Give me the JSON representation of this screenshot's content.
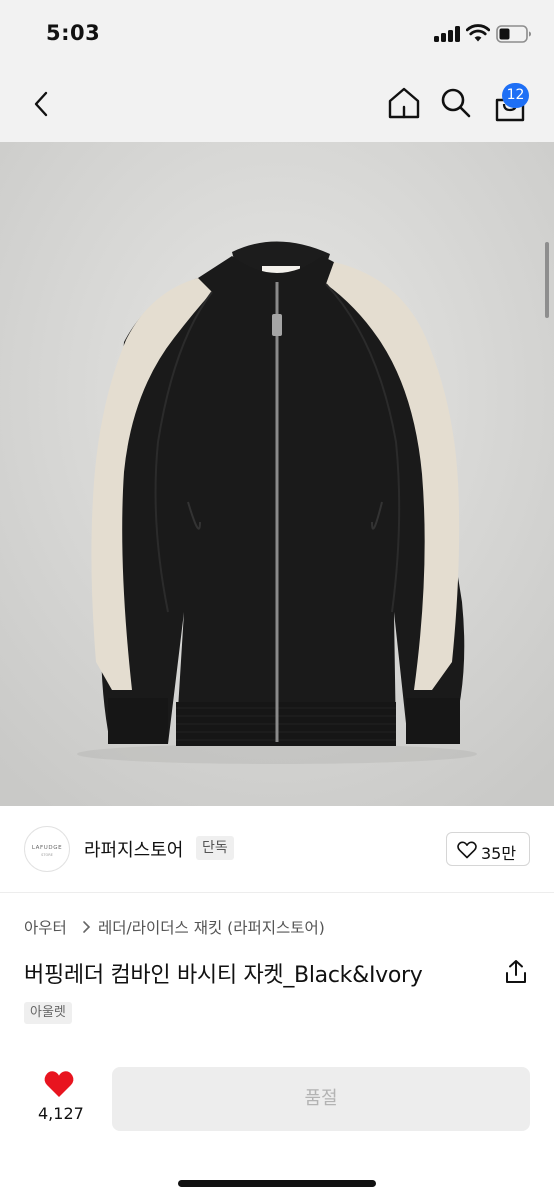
{
  "status_bar": {
    "time": "5:03"
  },
  "nav": {
    "cart_count": "12"
  },
  "seller": {
    "logo_text": "LAFUDGE",
    "logo_subtext": "STORE",
    "name": "라퍼지스토어",
    "badge": "단독",
    "like_count": "35만"
  },
  "product": {
    "breadcrumb_parent": "아우터",
    "breadcrumb_child": "레더/라이더스 재킷 (라퍼지스토어)",
    "title": "버핑레더 컴바인 바시티 자켓_Black&Ivory",
    "tag": "아울렛",
    "wish_count": "4,127",
    "sold_out_label": "품절"
  },
  "colors": {
    "badge_blue": "#1e6ff5",
    "heart_red": "#e8141f",
    "jacket_black": "#1a1a1a",
    "jacket_ivory": "#e4ddd0"
  },
  "icons": [
    "back-chevron-icon",
    "home-icon",
    "search-icon",
    "shopping-bag-icon",
    "heart-outline-icon",
    "share-icon",
    "heart-filled-icon"
  ]
}
